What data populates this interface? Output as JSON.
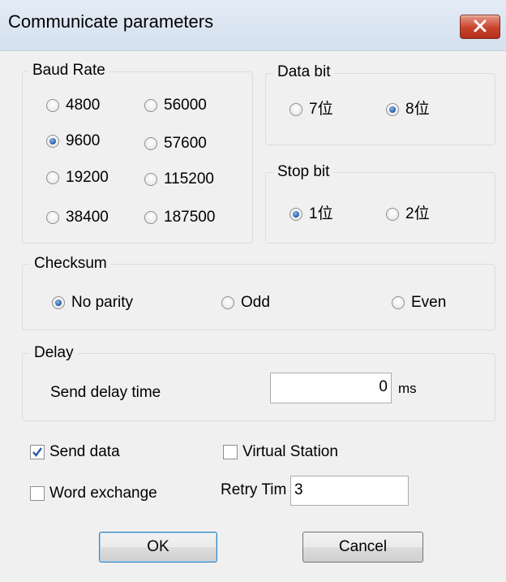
{
  "window": {
    "title": "Communicate parameters"
  },
  "baud_rate": {
    "legend": "Baud Rate",
    "options": [
      "4800",
      "56000",
      "9600",
      "57600",
      "19200",
      "115200",
      "38400",
      "187500"
    ],
    "selected": "9600"
  },
  "data_bit": {
    "legend": "Data bit",
    "options": [
      "7位",
      "8位"
    ],
    "selected": "8位"
  },
  "stop_bit": {
    "legend": "Stop bit",
    "options": [
      "1位",
      "2位"
    ],
    "selected": "1位"
  },
  "checksum": {
    "legend": "Checksum",
    "options": [
      "No parity",
      "Odd",
      "Even"
    ],
    "selected": "No parity"
  },
  "delay": {
    "legend": "Delay",
    "label": "Send delay time",
    "value": "0",
    "unit": "ms"
  },
  "options": {
    "send_data": {
      "label": "Send data",
      "checked": true
    },
    "virtual_station": {
      "label": "Virtual Station",
      "checked": false
    },
    "word_exchange": {
      "label": "Word exchange",
      "checked": false
    },
    "retry": {
      "label": "Retry Tim",
      "value": "3"
    }
  },
  "buttons": {
    "ok": "OK",
    "cancel": "Cancel"
  }
}
